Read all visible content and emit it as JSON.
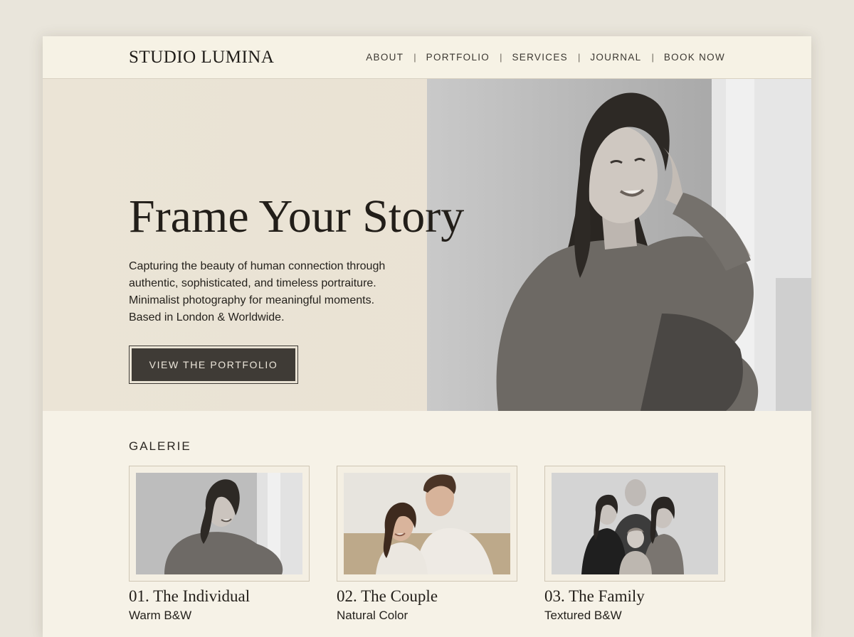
{
  "header": {
    "brand": "STUDIO LUMINA",
    "nav": [
      {
        "label": "ABOUT"
      },
      {
        "label": "PORTFOLIO"
      },
      {
        "label": "SERVICES"
      },
      {
        "label": "JOURNAL"
      },
      {
        "label": "BOOK NOW"
      }
    ],
    "separator": "|"
  },
  "hero": {
    "title": "Frame Your Story",
    "description": "Capturing the beauty of human connection through authentic, sophisticated, and timeless portraiture. Minimalist photography for meaningful moments. Based in London & Worldwide.",
    "cta_label": "VIEW THE PORTFOLIO"
  },
  "gallery": {
    "heading": "GALERIE",
    "cards": [
      {
        "title": "01. The Individual",
        "subtitle": "Warm B&W"
      },
      {
        "title": "02. The Couple",
        "subtitle": "Natural Color"
      },
      {
        "title": "03. The Family",
        "subtitle": "Textured B&W"
      }
    ]
  },
  "colors": {
    "page_bg": "#f6f2e7",
    "button_bg": "#3f3b36",
    "text": "#221e19"
  }
}
